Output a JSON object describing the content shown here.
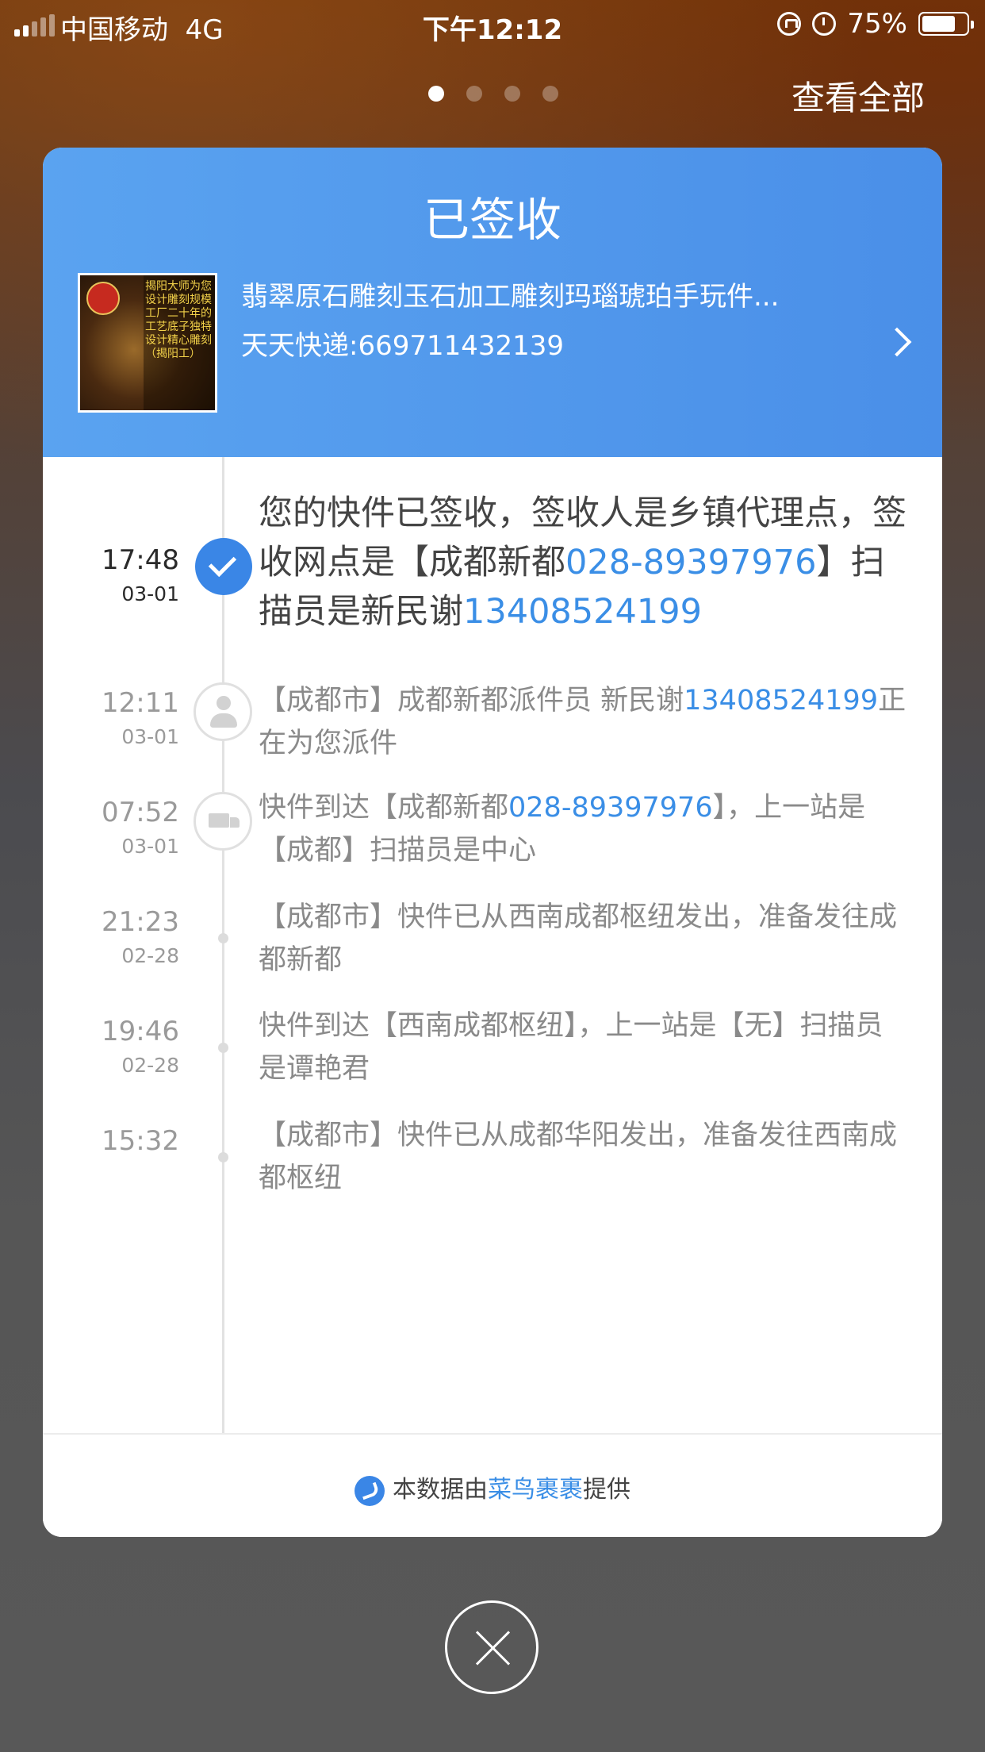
{
  "status_bar": {
    "carrier": "中国移动",
    "network": "4G",
    "time": "下午12:12",
    "battery_percent": "75%",
    "battery_level": 0.75
  },
  "pager": {
    "pages": 4,
    "active": 0
  },
  "view_all_label": "查看全部",
  "card": {
    "status_title": "已签收",
    "product_name": "翡翠原石雕刻玉石加工雕刻玛瑙琥珀手玩件...",
    "tracking": "天天快递:669711432139",
    "thumbnail_text": "揭阳大师为您设计雕刻规模工厂二十年的工艺底子独特设计精心雕刻（揭阳工）"
  },
  "events": [
    {
      "time": "17:48",
      "date": "03-01",
      "marker": "check-icon",
      "parts": [
        {
          "text": "您的快件已签收，签收人是乡镇代理点，签收网点是【成都新都"
        },
        {
          "text": "028-89397976",
          "link": true
        },
        {
          "text": "】扫描员是新民谢"
        },
        {
          "text": "13408524199",
          "link": true
        }
      ]
    },
    {
      "time": "12:11",
      "date": "03-01",
      "marker": "person-icon",
      "parts": [
        {
          "text": "【成都市】成都新都派件员 新民谢"
        },
        {
          "text": "13408524199",
          "link": true
        },
        {
          "text": "正在为您派件"
        }
      ]
    },
    {
      "time": "07:52",
      "date": "03-01",
      "marker": "truck-icon",
      "parts": [
        {
          "text": "快件到达【成都新都"
        },
        {
          "text": "028-89397976",
          "link": true
        },
        {
          "text": "】，上一站是【成都】扫描员是中心"
        }
      ]
    },
    {
      "time": "21:23",
      "date": "02-28",
      "marker": "dot",
      "parts": [
        {
          "text": "【成都市】快件已从西南成都枢纽发出，准备发往成都新都"
        }
      ]
    },
    {
      "time": "19:46",
      "date": "02-28",
      "marker": "dot",
      "parts": [
        {
          "text": "快件到达【西南成都枢纽】，上一站是【无】扫描员是谭艳君"
        }
      ]
    },
    {
      "time": "15:32",
      "date": "",
      "marker": "dot",
      "parts": [
        {
          "text": "【成都市】快件已从成都华阳发出，准备发往西南成都枢纽"
        }
      ]
    }
  ],
  "footer": {
    "prefix": "本数据由",
    "brand": "菜鸟裹裹",
    "suffix": "提供"
  }
}
